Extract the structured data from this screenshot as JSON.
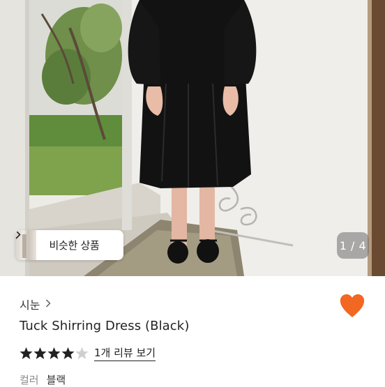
{
  "gallery": {
    "similar_button": {
      "label": "비슷한 상품",
      "chevron_icon": "chevron-right-icon"
    },
    "counter": "1 / 4"
  },
  "shop": {
    "name": "시눈",
    "chevron_icon": "chevron-right-icon"
  },
  "wishlist": {
    "icon": "heart-icon",
    "color": "#f26722",
    "active": true
  },
  "product": {
    "title": "Tuck Shirring Dress (Black)"
  },
  "rating": {
    "stars_filled": 4,
    "stars_total": 5,
    "star_color": "#222222",
    "star_empty_color": "#cfcfcf",
    "review_link": "1개 리뷰 보기"
  },
  "option": {
    "label": "컬러",
    "value": "블랙"
  }
}
